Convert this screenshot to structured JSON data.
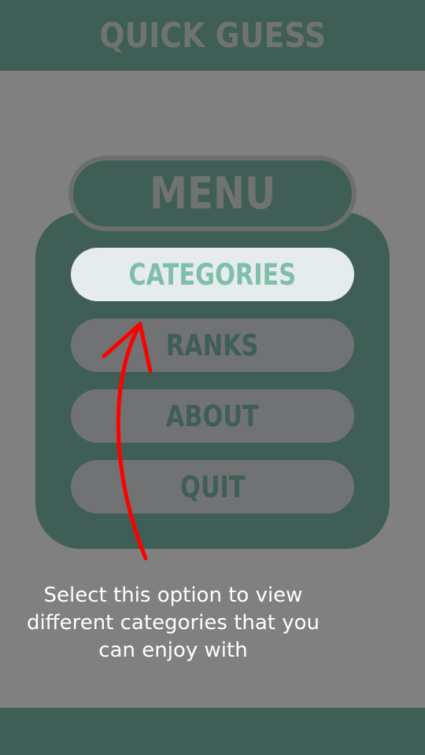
{
  "header": {
    "title": "QUICK GUESS"
  },
  "menu": {
    "title": "MENU",
    "items": [
      {
        "label": "CATEGORIES",
        "selected": true
      },
      {
        "label": "RANKS",
        "selected": false
      },
      {
        "label": "ABOUT",
        "selected": false
      },
      {
        "label": "QUIT",
        "selected": false
      }
    ]
  },
  "tutorial": {
    "hint_text": "Select this option to view different categories that you can enjoy with",
    "arrow_color": "#ff0000"
  },
  "colors": {
    "background": "#808080",
    "bar": "#3f5e56",
    "button": "#717273",
    "button_selected": "#e6ecee",
    "button_selected_text": "#7fbfa9"
  }
}
